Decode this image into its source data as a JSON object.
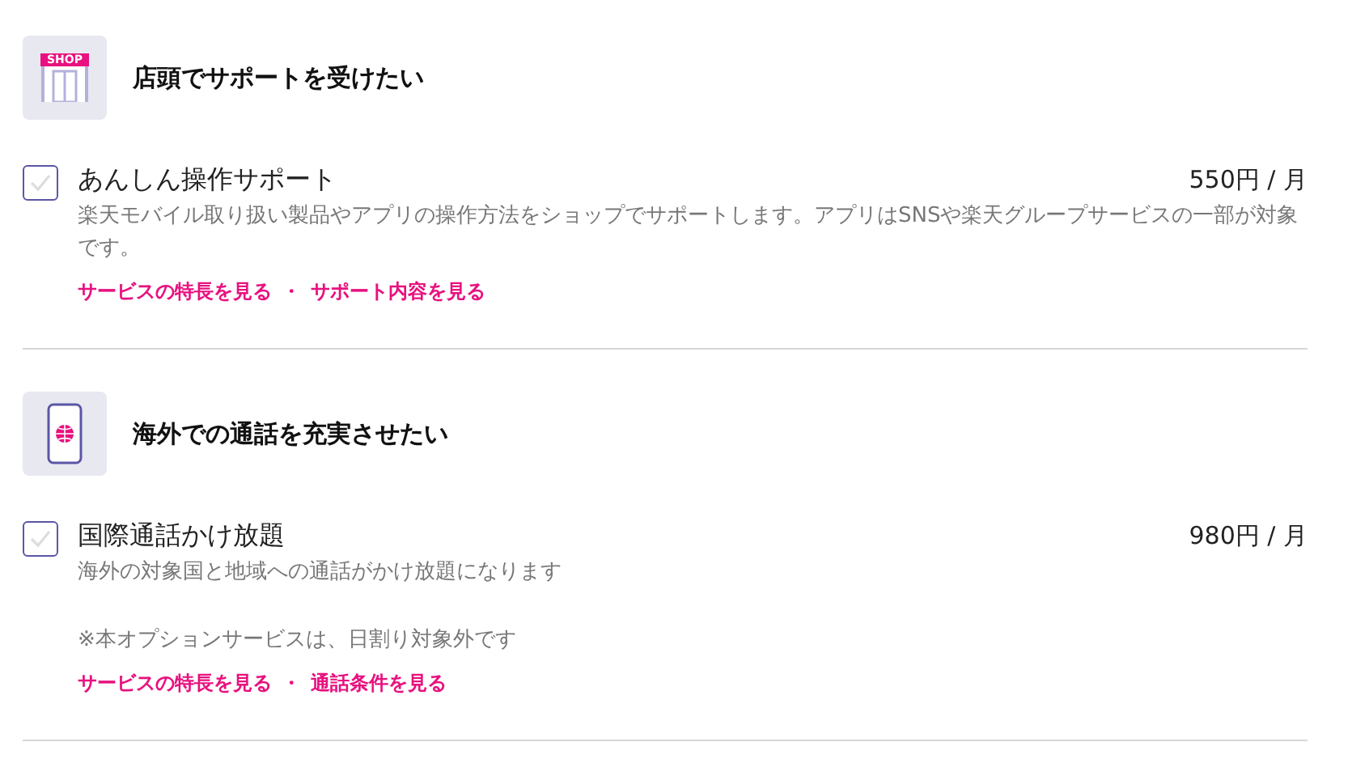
{
  "sections": [
    {
      "icon": {
        "kind": "shop",
        "label": "SHOP"
      },
      "title": "店頭でサポートを受けたい",
      "options": [
        {
          "name": "あんしん操作サポート",
          "checked": false,
          "price": "550円 / 月",
          "description": "楽天モバイル取り扱い製品やアプリの操作方法をショップでサポートします。アプリはSNSや楽天グループサービスの一部が対象です。",
          "links": [
            "サービスの特長を見る",
            "サポート内容を見る"
          ],
          "link_separator": "・"
        }
      ]
    },
    {
      "icon": {
        "kind": "phone"
      },
      "title": "海外での通話を充実させたい",
      "options": [
        {
          "name": "国際通話かけ放題",
          "checked": false,
          "price": "980円 / 月",
          "description": "海外の対象国と地域への通話がかけ放題になります",
          "note": "※本オプションサービスは、日割り対象外です",
          "links": [
            "サービスの特長を見る",
            "通話条件を見る"
          ],
          "link_separator": "・"
        }
      ]
    }
  ]
}
